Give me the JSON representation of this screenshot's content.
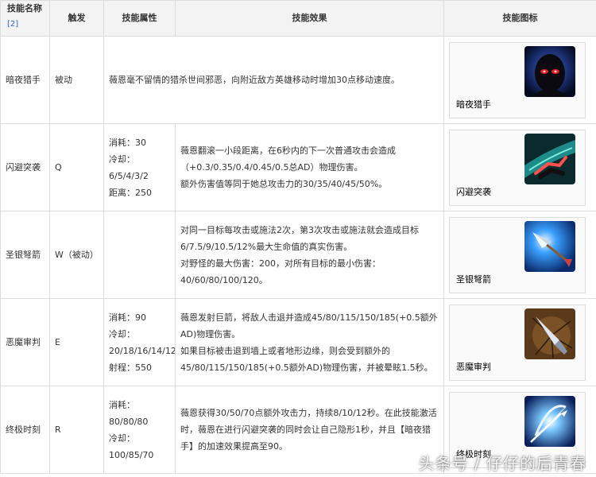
{
  "headers": {
    "name": "技能名称",
    "ref": "[2]",
    "trigger": "触发",
    "attributes": "技能属性",
    "effect": "技能效果",
    "icon": "技能图标"
  },
  "skills": [
    {
      "name": "暗夜猎手",
      "trigger": "被动",
      "attributes": [],
      "effect": [
        "薇恩毫不留情的猎杀世间邪恶，向附近敌方英雄移动时增加30点移动速度。"
      ],
      "icon_name": "night-hunter-icon",
      "icon_label": "暗夜猎手"
    },
    {
      "name": "闪避突袭",
      "trigger": "Q",
      "attributes": [
        "消耗：30",
        "冷却：6/5/4/3/2",
        "距离：250"
      ],
      "effect": [
        "薇恩翻滚一小段距离，在6秒内的下一次普通攻击会造成（+0.3/0.35/0.4/0.45/0.5总AD）物理伤害。",
        "额外伤害值等同于她总攻击力的30/35/40/45/50%。"
      ],
      "icon_name": "tumble-icon",
      "icon_label": "闪避突袭"
    },
    {
      "name": "圣银弩箭",
      "trigger": "W（被动）",
      "attributes": [],
      "effect": [
        "对同一目标每攻击或施法2次，第3次攻击或施法就会造成目标6/7.5/9/10.5/12%最大生命值的真实伤害。",
        "对野怪的最大伤害：200，对所有目标的最小伤害：40/60/80/100/120。"
      ],
      "icon_name": "silver-bolts-icon",
      "icon_label": "圣银弩箭"
    },
    {
      "name": "恶魔审判",
      "trigger": "E",
      "attributes": [
        "消耗：90",
        "冷却：20/18/16/14/12",
        "射程：550"
      ],
      "effect": [
        "薇恩发射巨箭，将敌人击退并造成45/80/115/150/185(+0.5额外AD)物理伤害。",
        "如果目标被击退到墙上或者地形边缘，则会受到额外的45/80/115/150/185(+0.5额外AD)物理伤害，并被晕眩1.5秒。"
      ],
      "icon_name": "condemn-icon",
      "icon_label": "恶魔审判"
    },
    {
      "name": "终极时刻",
      "trigger": "R",
      "attributes": [
        "消耗：80/80/80",
        "冷却：100/85/70"
      ],
      "effect": [
        "薇恩获得30/50/70点额外攻击力，持续8/10/12秒。在此技能激活时，薇恩在进行闪避突袭的同时会让自己隐形1秒，并且【暗夜猎手】的加速效果提高至90。"
      ],
      "icon_name": "final-hour-icon",
      "icon_label": "终极时刻"
    }
  ],
  "watermark": "头条号 / 仔仔的后青春"
}
